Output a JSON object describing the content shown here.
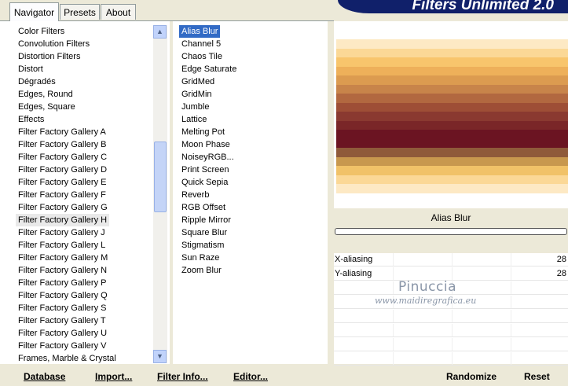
{
  "app": {
    "title": "Filters Unlimited 2.0"
  },
  "tabs": [
    {
      "label": "Navigator",
      "active": true
    },
    {
      "label": "Presets",
      "active": false
    },
    {
      "label": "About",
      "active": false
    }
  ],
  "categories": {
    "selected_index": 16,
    "items": [
      "Color Filters",
      "Convolution Filters",
      "Distortion Filters",
      "Distort",
      "Dégradés",
      "Edges, Round",
      "Edges, Square",
      "Effects",
      "Filter Factory Gallery A",
      "Filter Factory Gallery B",
      "Filter Factory Gallery C",
      "Filter Factory Gallery D",
      "Filter Factory Gallery E",
      "Filter Factory Gallery F",
      "Filter Factory Gallery G",
      "Filter Factory Gallery H",
      "Filter Factory Gallery J",
      "Filter Factory Gallery L",
      "Filter Factory Gallery M",
      "Filter Factory Gallery N",
      "Filter Factory Gallery P",
      "Filter Factory Gallery Q",
      "Filter Factory Gallery S",
      "Filter Factory Gallery T",
      "Filter Factory Gallery U",
      "Filter Factory Gallery V",
      "Frames, Marble & Crystal"
    ]
  },
  "filters": {
    "selected_index": 0,
    "items": [
      "Alias Blur",
      "Channel 5",
      "Chaos Tile",
      "Edge Saturate",
      "GridMed",
      "GridMin",
      "Jumble",
      "Lattice",
      "Melting Pot",
      "Moon Phase",
      "NoiseyRGB...",
      "Print Screen",
      "Quick Sepia",
      "Reverb",
      "RGB Offset",
      "Ripple Mirror",
      "Square Blur",
      "Stigmatism",
      "Sun Raze",
      "Zoom Blur"
    ]
  },
  "preview": {
    "effect_name": "Alias Blur",
    "stripe_colors": [
      "#fde9c4",
      "#fbd896",
      "#f8c56c",
      "#eeb05a",
      "#dc9b50",
      "#c8844a",
      "#b26840",
      "#9e4e36",
      "#8a3930",
      "#7a2628",
      "#6b1422",
      "#6b1422",
      "#8f5a3a",
      "#c8984e",
      "#f1c268",
      "#fbd896",
      "#fde9c4"
    ]
  },
  "params": [
    {
      "label": "X-aliasing",
      "value": "28"
    },
    {
      "label": "Y-aliasing",
      "value": "28"
    }
  ],
  "watermark": {
    "line1": "Pinuccia",
    "line2": "www.maidiregrafica.eu"
  },
  "buttons": {
    "database": "Database",
    "import": "Import...",
    "filter_info": "Filter Info...",
    "editor": "Editor...",
    "randomize": "Randomize",
    "reset": "Reset"
  }
}
